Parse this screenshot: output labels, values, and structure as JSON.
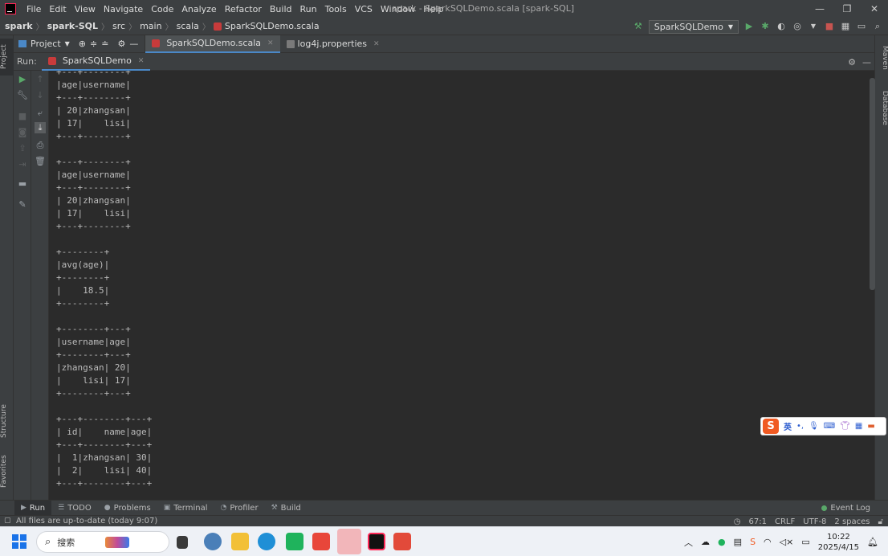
{
  "window": {
    "title": "spark - SparkSQLDemo.scala [spark-SQL]",
    "menu": [
      "File",
      "Edit",
      "View",
      "Navigate",
      "Code",
      "Analyze",
      "Refactor",
      "Build",
      "Run",
      "Tools",
      "VCS",
      "Window",
      "Help"
    ],
    "controls": [
      "—",
      "❐",
      "✕"
    ]
  },
  "breadcrumb": [
    "spark",
    "spark-SQL",
    "src",
    "main",
    "scala",
    "SparkSQLDemo.scala"
  ],
  "run_config": "SparkSQLDemo",
  "project_selector": "Project",
  "editor_tabs": [
    {
      "label": "SparkSQLDemo.scala",
      "active": true
    },
    {
      "label": "log4j.properties",
      "active": false
    }
  ],
  "left_strip": {
    "project": "Project",
    "structure": "Structure",
    "favorites": "Favorites"
  },
  "right_strip": {
    "maven": "Maven",
    "database": "Database"
  },
  "run_panel": {
    "label": "Run:",
    "tab": "SparkSQLDemo"
  },
  "console_lines": [
    "+---+--------+",
    "|age|username|",
    "+---+--------+",
    "| 20|zhangsan|",
    "| 17|    lisi|",
    "+---+--------+",
    "",
    "+---+--------+",
    "|age|username|",
    "+---+--------+",
    "| 20|zhangsan|",
    "| 17|    lisi|",
    "+---+--------+",
    "",
    "+--------+",
    "|avg(age)|",
    "+--------+",
    "|    18.5|",
    "+--------+",
    "",
    "+--------+---+",
    "|username|age|",
    "+--------+---+",
    "|zhangsan| 20|",
    "|    lisi| 17|",
    "+--------+---+",
    "",
    "+---+--------+---+",
    "| id|    name|age|",
    "+---+--------+---+",
    "|  1|zhangsan| 30|",
    "|  2|    lisi| 40|",
    "+---+--------+---+"
  ],
  "ime": {
    "logo": "S",
    "lang": "英"
  },
  "bottom_tabs": [
    "Run",
    "TODO",
    "Problems",
    "Terminal",
    "Profiler",
    "Build"
  ],
  "event_log": "Event Log",
  "status": {
    "message": "All files are up-to-date (today 9:07)",
    "position": "67:1",
    "line_sep": "CRLF",
    "encoding": "UTF-8",
    "indent": "2 spaces"
  },
  "taskbar": {
    "search_placeholder": "搜索",
    "time": "10:22",
    "date": "2025/4/15"
  }
}
